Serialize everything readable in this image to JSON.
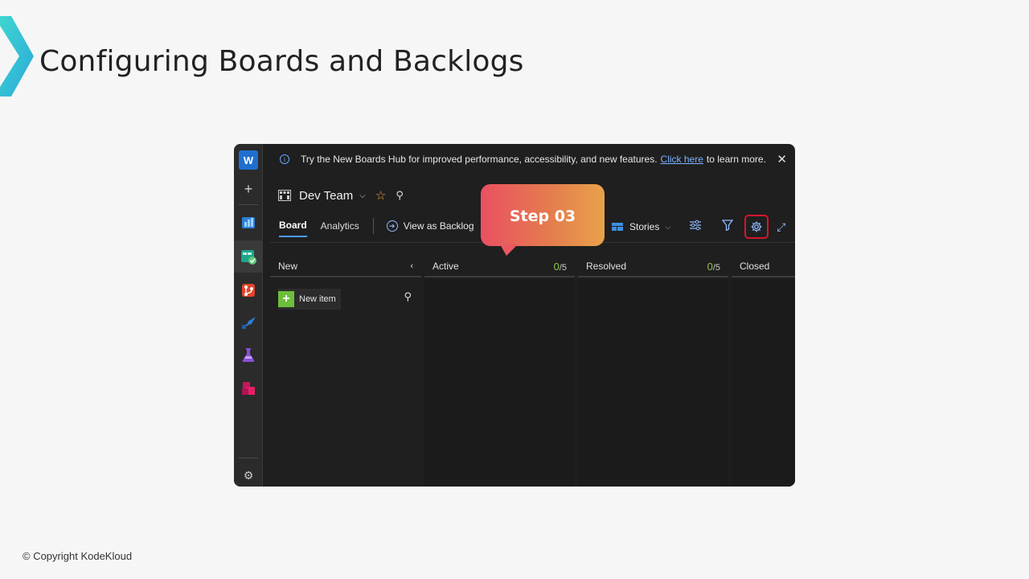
{
  "slide": {
    "title": "Configuring Boards and Backlogs",
    "copyright": "© Copyright KodeKloud"
  },
  "rail": {
    "logo_letter": "W",
    "plus_label": "+",
    "settings_glyph": "⚙",
    "icons": [
      "overview-icon",
      "boards-icon",
      "repos-icon",
      "pipelines-icon",
      "test-plans-icon",
      "artifacts-icon"
    ]
  },
  "banner": {
    "text": "Try the New Boards Hub for improved performance, accessibility, and new features.",
    "link": "Click here",
    "suffix": "to learn more.",
    "close": "✕"
  },
  "team": {
    "name": "Dev Team",
    "star": "☆",
    "people": "⚲"
  },
  "tabs": [
    {
      "label": "Board",
      "active": true
    },
    {
      "label": "Analytics",
      "active": false
    }
  ],
  "view_as_backlog": "View as Backlog",
  "backlog_level": "Stories",
  "toolbar_colors": {
    "highlight": "#d6152e",
    "accent": "#8fbaff"
  },
  "callout": {
    "label": "Step 03"
  },
  "columns": [
    {
      "name": "New",
      "collapse": "‹"
    },
    {
      "name": "Active",
      "current": "0",
      "limit": "/5"
    },
    {
      "name": "Resolved",
      "current": "0",
      "limit": "/5"
    },
    {
      "name": "Closed"
    }
  ],
  "new_item_label": "New item"
}
